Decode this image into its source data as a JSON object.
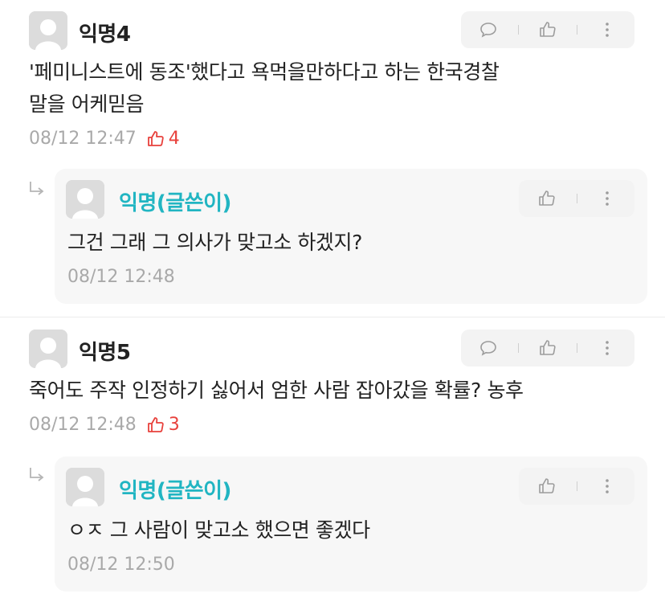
{
  "comments": [
    {
      "author": "익명4",
      "text": "'페미니스트에 동조'했다고 욕먹을만하다고 하는 한국경찰\n말을 어케믿음",
      "time": "08/12 12:47",
      "likes": "4",
      "reply": {
        "author": "익명(글쓴이)",
        "text": "그건 그래 그 의사가 맞고소 하겠지?",
        "time": "08/12 12:48"
      }
    },
    {
      "author": "익명5",
      "text": "죽어도 주작 인정하기 싫어서 엄한 사람 잡아갔을 확률? 농후",
      "time": "08/12 12:48",
      "likes": "3",
      "reply": {
        "author": "익명(글쓴이)",
        "text": "ㅇㅈ 그 사람이 맞고소 했으면 좋겠다",
        "time": "08/12 12:50"
      }
    }
  ],
  "icons": {
    "comment": "speech-bubble-icon",
    "like": "thumbs-up-icon",
    "more": "vertical-dots-icon",
    "reply": "reply-arrow-icon",
    "avatar": "default-avatar-icon"
  },
  "colors": {
    "op_name": "#21b5c2",
    "like_count": "#e8413c",
    "meta": "#a9a9a9",
    "action_bg": "#f3f3f3",
    "reply_bg": "#f7f7f7"
  }
}
